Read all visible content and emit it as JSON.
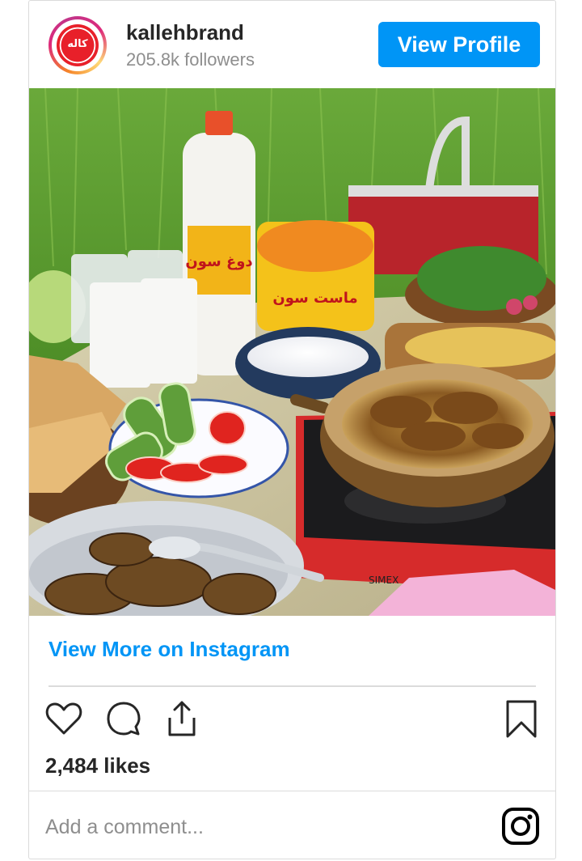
{
  "profile": {
    "username": "kallehbrand",
    "followers": "205.8k followers",
    "view_profile_label": "View Profile",
    "avatar_logo_text": "کاله"
  },
  "post": {
    "view_more_label": "View More on Instagram",
    "likes": "2,484 likes",
    "comment_placeholder": "Add a comment...",
    "product_labels": {
      "bottle": "دوغ سون",
      "tub": "ماست سون"
    }
  },
  "icons": {
    "like": "heart-icon",
    "comment": "comment-icon",
    "share": "share-icon",
    "save": "bookmark-icon",
    "instagram": "instagram-icon"
  },
  "colors": {
    "accent": "#0095f6",
    "text": "#262626",
    "muted": "#8e8e8e",
    "border": "#dbdbdb",
    "brand_red": "#e8202a"
  }
}
